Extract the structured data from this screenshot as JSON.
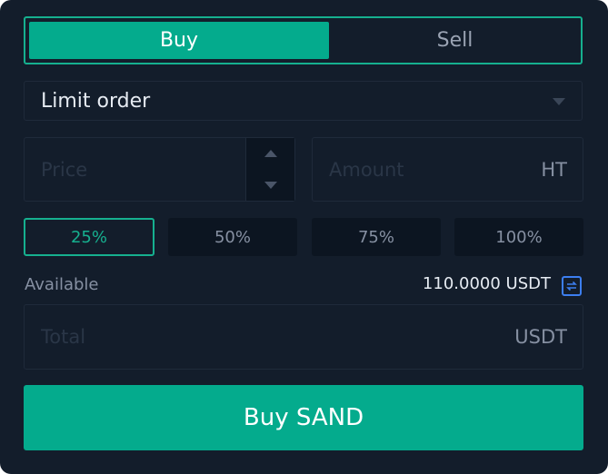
{
  "tabs": {
    "buy_label": "Buy",
    "sell_label": "Sell",
    "active": "Buy"
  },
  "order_type": {
    "selected": "Limit order"
  },
  "price": {
    "placeholder": "Price",
    "value": ""
  },
  "amount": {
    "placeholder": "Amount",
    "value": "",
    "unit": "HT"
  },
  "percent_options": [
    {
      "label": "25%",
      "active": true
    },
    {
      "label": "50%",
      "active": false
    },
    {
      "label": "75%",
      "active": false
    },
    {
      "label": "100%",
      "active": false
    }
  ],
  "available": {
    "label": "Available",
    "value": "110.0000 USDT"
  },
  "total": {
    "placeholder": "Total",
    "value": "",
    "unit": "USDT"
  },
  "submit": {
    "label": "Buy SAND"
  },
  "icons": {
    "dropdown": "caret-down-icon",
    "stepper_up": "arrow-up-icon",
    "stepper_down": "arrow-down-icon",
    "swap": "swap-icon"
  },
  "colors": {
    "background": "#131d2b",
    "accent": "#04ab8d",
    "accent_border": "#16b08f",
    "swap_icon": "#3c7ef0",
    "muted_text": "#8690a2",
    "primary_text": "#e6ebf2"
  }
}
